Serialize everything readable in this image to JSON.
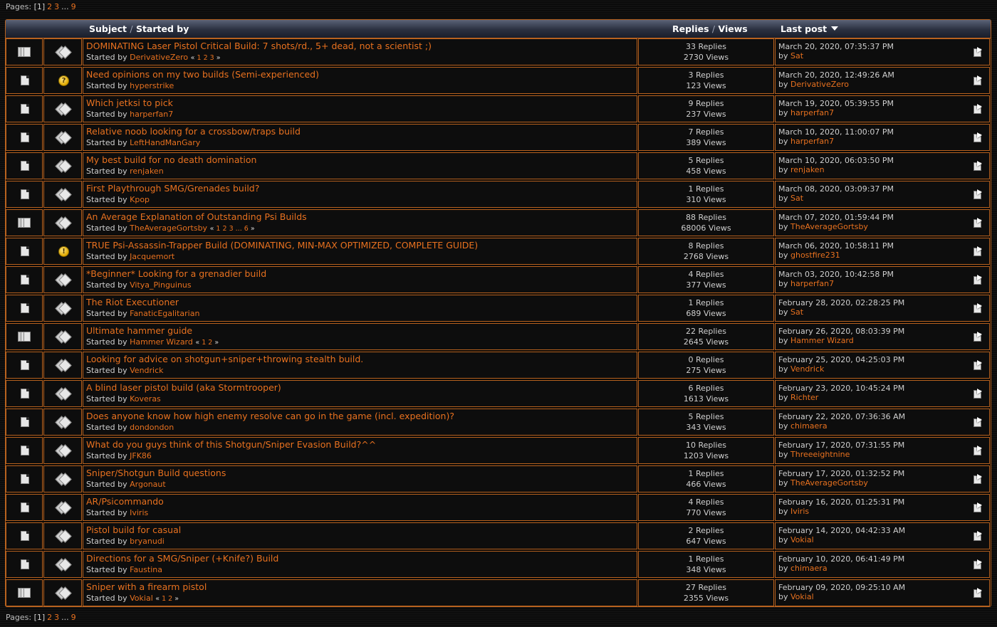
{
  "pagination": {
    "label": "Pages:",
    "current": "[1]",
    "pages": [
      "2",
      "3"
    ],
    "ellipsis": "...",
    "last": "9"
  },
  "header": {
    "subject": "Subject",
    "separator": "/",
    "started_by": "Started by",
    "replies": "Replies",
    "views": "Views",
    "last_post": "Last post"
  },
  "labels": {
    "started_by_prefix": "Started by",
    "by_prefix": "by",
    "mini_open": "«",
    "mini_close": "»"
  },
  "topics": [
    {
      "title": "DOMINATING Laser Pistol Critical Build: 7 shots/rd., 5+ dead, not a scientist ;)",
      "author": "DerivativeZero",
      "pages": [
        "1",
        "2",
        "3"
      ],
      "replies": "33 Replies",
      "views": "2730 Views",
      "last_date": "March 20, 2020, 07:35:37 PM",
      "last_by": "Sat",
      "icon": "hot",
      "type": "diamond"
    },
    {
      "title": "Need opinions on my two builds (Semi-experienced)",
      "author": "hyperstrike",
      "pages": [],
      "replies": "3 Replies",
      "views": "123 Views",
      "last_date": "March 20, 2020, 12:49:26 AM",
      "last_by": "DerivativeZero",
      "icon": "normal",
      "type": "question"
    },
    {
      "title": "Which jetksi to pick",
      "author": "harperfan7",
      "pages": [],
      "replies": "9 Replies",
      "views": "237 Views",
      "last_date": "March 19, 2020, 05:39:55 PM",
      "last_by": "harperfan7",
      "icon": "normal",
      "type": "diamond"
    },
    {
      "title": "Relative noob looking for a crossbow/traps build",
      "author": "LeftHandManGary",
      "pages": [],
      "replies": "7 Replies",
      "views": "389 Views",
      "last_date": "March 10, 2020, 11:00:07 PM",
      "last_by": "harperfan7",
      "icon": "normal",
      "type": "diamond"
    },
    {
      "title": "My best build for no death domination",
      "author": "renjaken",
      "pages": [],
      "replies": "5 Replies",
      "views": "458 Views",
      "last_date": "March 10, 2020, 06:03:50 PM",
      "last_by": "renjaken",
      "icon": "normal",
      "type": "diamond"
    },
    {
      "title": "First Playthrough SMG/Grenades build?",
      "author": "Kpop",
      "pages": [],
      "replies": "1 Replies",
      "views": "310 Views",
      "last_date": "March 08, 2020, 03:09:37 PM",
      "last_by": "Sat",
      "icon": "normal",
      "type": "diamond"
    },
    {
      "title": "An Average Explanation of Outstanding Psi Builds",
      "author": "TheAverageGortsby",
      "pages": [
        "1",
        "2",
        "3",
        "...",
        "6"
      ],
      "replies": "88 Replies",
      "views": "68006 Views",
      "last_date": "March 07, 2020, 01:59:44 PM",
      "last_by": "TheAverageGortsby",
      "icon": "hot",
      "type": "diamond"
    },
    {
      "title": "TRUE Psi-Assassin-Trapper Build (DOMINATING, MIN-MAX OPTIMIZED, COMPLETE GUIDE)",
      "author": "Jacquemort",
      "pages": [],
      "replies": "8 Replies",
      "views": "2768 Views",
      "last_date": "March 06, 2020, 10:58:11 PM",
      "last_by": "ghostfire231",
      "icon": "normal",
      "type": "exclamation"
    },
    {
      "title": "*Beginner* Looking for a grenadier build",
      "author": "Vitya_Pinguinus",
      "pages": [],
      "replies": "4 Replies",
      "views": "377 Views",
      "last_date": "March 03, 2020, 10:42:58 PM",
      "last_by": "harperfan7",
      "icon": "normal",
      "type": "diamond"
    },
    {
      "title": "The Riot Executioner",
      "author": "FanaticEgalitarian",
      "pages": [],
      "replies": "1 Replies",
      "views": "689 Views",
      "last_date": "February 28, 2020, 02:28:25 PM",
      "last_by": "Sat",
      "icon": "normal",
      "type": "diamond"
    },
    {
      "title": "Ultimate hammer guide",
      "author": "Hammer Wizard",
      "pages": [
        "1",
        "2"
      ],
      "replies": "22 Replies",
      "views": "2645 Views",
      "last_date": "February 26, 2020, 08:03:39 PM",
      "last_by": "Hammer Wizard",
      "icon": "multi",
      "type": "diamond"
    },
    {
      "title": "Looking for advice on shotgun+sniper+throwing stealth build.",
      "author": "Vendrick",
      "pages": [],
      "replies": "0 Replies",
      "views": "275 Views",
      "last_date": "February 25, 2020, 04:25:03 PM",
      "last_by": "Vendrick",
      "icon": "normal",
      "type": "diamond"
    },
    {
      "title": "A blind laser pistol build (aka Stormtrooper)",
      "author": "Koveras",
      "pages": [],
      "replies": "6 Replies",
      "views": "1613 Views",
      "last_date": "February 23, 2020, 10:45:24 PM",
      "last_by": "Richter",
      "icon": "normal",
      "type": "diamond"
    },
    {
      "title": "Does anyone know how high enemy resolve can go in the game (incl. expedition)?",
      "author": "dondondon",
      "pages": [],
      "replies": "5 Replies",
      "views": "343 Views",
      "last_date": "February 22, 2020, 07:36:36 AM",
      "last_by": "chimaera",
      "icon": "normal",
      "type": "diamond"
    },
    {
      "title": "What do you guys think of this Shotgun/Sniper Evasion Build?^^",
      "author": "JFK86",
      "pages": [],
      "replies": "10 Replies",
      "views": "1203 Views",
      "last_date": "February 17, 2020, 07:31:55 PM",
      "last_by": "Threeeightnine",
      "icon": "normal",
      "type": "diamond"
    },
    {
      "title": "Sniper/Shotgun Build questions",
      "author": "Argonaut",
      "pages": [],
      "replies": "1 Replies",
      "views": "466 Views",
      "last_date": "February 17, 2020, 01:32:52 PM",
      "last_by": "TheAverageGortsby",
      "icon": "normal",
      "type": "diamond"
    },
    {
      "title": "AR/Psicommando",
      "author": "Iviris",
      "pages": [],
      "replies": "4 Replies",
      "views": "770 Views",
      "last_date": "February 16, 2020, 01:25:31 PM",
      "last_by": "Iviris",
      "icon": "normal",
      "type": "diamond"
    },
    {
      "title": "Pistol build for casual",
      "author": "bryanudi",
      "pages": [],
      "replies": "2 Replies",
      "views": "647 Views",
      "last_date": "February 14, 2020, 04:42:33 AM",
      "last_by": "Vokial",
      "icon": "normal",
      "type": "diamond"
    },
    {
      "title": "Directions for a SMG/Sniper (+Knife?) Build",
      "author": "Faustina",
      "pages": [],
      "replies": "1 Replies",
      "views": "348 Views",
      "last_date": "February 10, 2020, 06:41:49 PM",
      "last_by": "chimaera",
      "icon": "normal",
      "type": "diamond"
    },
    {
      "title": "Sniper with a firearm pistol",
      "author": "Vokial",
      "pages": [
        "1",
        "2"
      ],
      "replies": "27 Replies",
      "views": "2355 Views",
      "last_date": "February 09, 2020, 09:25:10 AM",
      "last_by": "Vokial",
      "icon": "hot",
      "type": "diamond"
    }
  ]
}
